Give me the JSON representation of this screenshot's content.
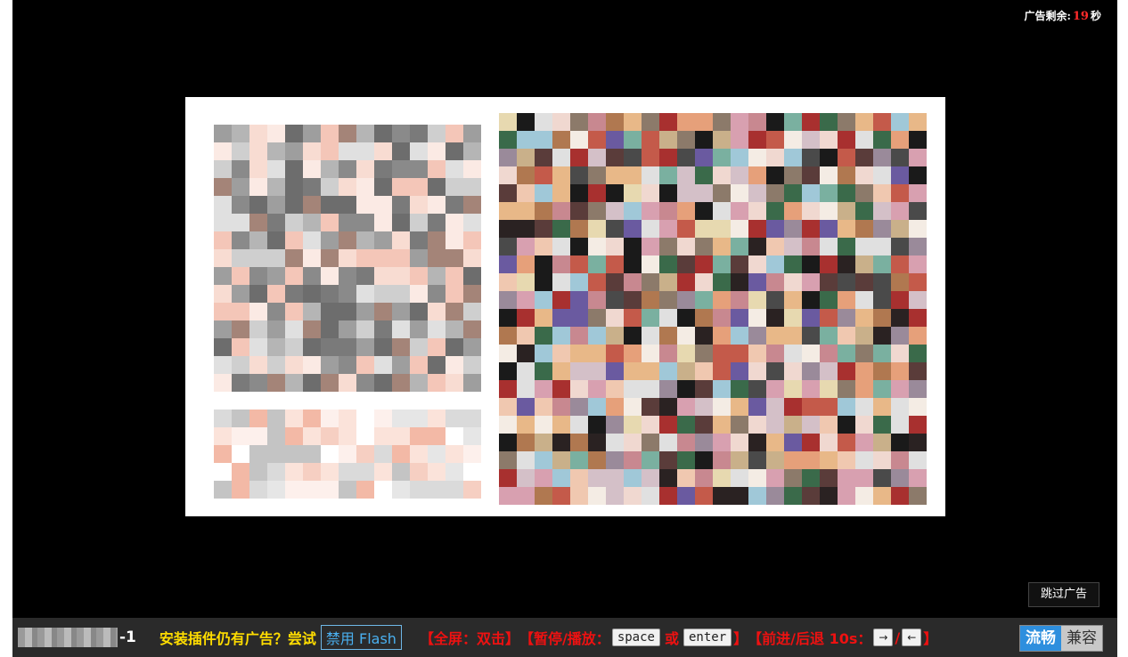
{
  "countdown": {
    "label": "广告剩余:",
    "seconds": "19",
    "unit": "秒"
  },
  "skip_ad": {
    "label": "跳过广告"
  },
  "toolbar": {
    "episode": "-1",
    "plugin_tip": "安装插件仍有广告？尝试",
    "disable_flash": "禁用 Flash",
    "fullscreen": "【全屏：双击】",
    "pause_prefix": "【暂停/播放：",
    "key_space": "space",
    "or": "或",
    "key_enter": "enter",
    "pause_suffix": "】",
    "seek_prefix": "【前进/后退 10s：",
    "key_forward": "→",
    "slash": "/",
    "key_back": "←",
    "seek_suffix": "】",
    "mode_fluent": "流畅",
    "mode_compat": "兼容"
  },
  "colors": {
    "player_bg": "#000000",
    "countdown_number": "#ff2a2a",
    "plugin_tip": "#ffdd00",
    "shortcut_text": "#ee1111",
    "fluent_active": "#2e8fde"
  }
}
